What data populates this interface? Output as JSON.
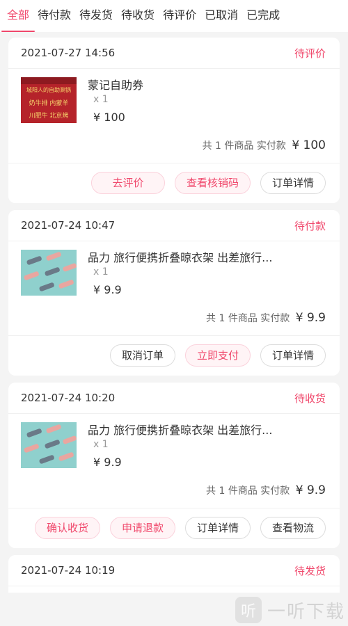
{
  "tabs": [
    "全部",
    "待付款",
    "待发货",
    "待收货",
    "待评价",
    "已取消",
    "已完成"
  ],
  "orders": [
    {
      "time": "2021-07-27 14:56",
      "status": "待评价",
      "item": {
        "title": "蒙记自助券",
        "qty": "x 1",
        "price": "¥ 100",
        "thumb_text": "城阳人的自助涮锅 | 奶牛排 内蒙羊 | 川肥牛 北京烤"
      },
      "summary": {
        "text": "共 1 件商品 实付款",
        "total": "¥ 100"
      },
      "buttons": [
        "去评价",
        "查看核销码",
        "订单详情"
      ]
    },
    {
      "time": "2021-07-24 10:47",
      "status": "待付款",
      "item": {
        "title": "品力 旅行便携折叠晾衣架 出差旅行...",
        "qty": "x 1",
        "price": "¥ 9.9"
      },
      "summary": {
        "text": "共 1 件商品 实付款",
        "total": "¥ 9.9"
      },
      "buttons": [
        "取消订单",
        "立即支付",
        "订单详情"
      ]
    },
    {
      "time": "2021-07-24 10:20",
      "status": "待收货",
      "item": {
        "title": "品力 旅行便携折叠晾衣架 出差旅行...",
        "qty": "x 1",
        "price": "¥ 9.9"
      },
      "summary": {
        "text": "共 1 件商品 实付款",
        "total": "¥ 9.9"
      },
      "buttons": [
        "确认收货",
        "申请退款",
        "订单详情",
        "查看物流"
      ]
    },
    {
      "time": "2021-07-24 10:19",
      "status": "待发货"
    }
  ],
  "watermark": {
    "badge": "听",
    "text": "一听下载"
  },
  "colors": {
    "accent": "#f0476b"
  }
}
